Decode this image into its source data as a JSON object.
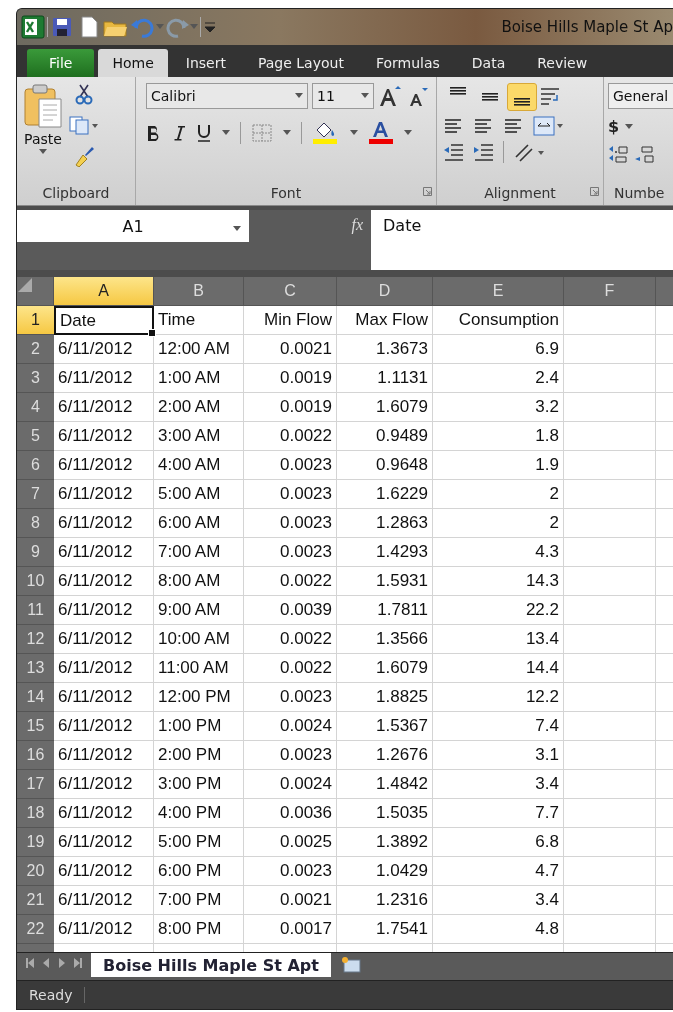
{
  "window": {
    "title": "Boise Hills Maple St Ap"
  },
  "tabs": [
    {
      "label": "File",
      "kind": "file",
      "selected": false
    },
    {
      "label": "Home",
      "kind": "tab",
      "selected": true
    },
    {
      "label": "Insert",
      "kind": "tab",
      "selected": false
    },
    {
      "label": "Page Layout",
      "kind": "tab",
      "selected": false
    },
    {
      "label": "Formulas",
      "kind": "tab",
      "selected": false
    },
    {
      "label": "Data",
      "kind": "tab",
      "selected": false
    },
    {
      "label": "Review",
      "kind": "tab",
      "selected": false
    }
  ],
  "ribbon": {
    "clipboard": {
      "label": "Clipboard",
      "paste": "Paste"
    },
    "font": {
      "label": "Font",
      "font_name": "Calibri",
      "font_size": "11"
    },
    "alignment": {
      "label": "Alignment",
      "vertical_align": [
        {
          "kind": "top",
          "selected": false
        },
        {
          "kind": "middle",
          "selected": false
        },
        {
          "kind": "bottom",
          "selected": true
        }
      ]
    },
    "number": {
      "label": "Numbe",
      "format": "General",
      "currency": "$"
    }
  },
  "formula_bar": {
    "name_box": "A1",
    "function_label": "fx",
    "content": "Date"
  },
  "columns": [
    {
      "label": "A",
      "selected": true
    },
    {
      "label": "B",
      "selected": false
    },
    {
      "label": "C",
      "selected": false
    },
    {
      "label": "D",
      "selected": false
    },
    {
      "label": "E",
      "selected": false
    },
    {
      "label": "F",
      "selected": false
    }
  ],
  "rows": [
    {
      "header": "1",
      "selected": true,
      "cells": [
        "Date",
        "Time",
        "Min Flow",
        "Max Flow",
        "Consumption"
      ]
    },
    {
      "header": "2",
      "selected": false,
      "cells": [
        "6/11/2012",
        "12:00 AM",
        "0.0021",
        "1.3673",
        "6.9"
      ]
    },
    {
      "header": "3",
      "selected": false,
      "cells": [
        "6/11/2012",
        "1:00 AM",
        "0.0019",
        "1.1131",
        "2.4"
      ]
    },
    {
      "header": "4",
      "selected": false,
      "cells": [
        "6/11/2012",
        "2:00 AM",
        "0.0019",
        "1.6079",
        "3.2"
      ]
    },
    {
      "header": "5",
      "selected": false,
      "cells": [
        "6/11/2012",
        "3:00 AM",
        "0.0022",
        "0.9489",
        "1.8"
      ]
    },
    {
      "header": "6",
      "selected": false,
      "cells": [
        "6/11/2012",
        "4:00 AM",
        "0.0023",
        "0.9648",
        "1.9"
      ]
    },
    {
      "header": "7",
      "selected": false,
      "cells": [
        "6/11/2012",
        "5:00 AM",
        "0.0023",
        "1.6229",
        "2"
      ]
    },
    {
      "header": "8",
      "selected": false,
      "cells": [
        "6/11/2012",
        "6:00 AM",
        "0.0023",
        "1.2863",
        "2"
      ]
    },
    {
      "header": "9",
      "selected": false,
      "cells": [
        "6/11/2012",
        "7:00 AM",
        "0.0023",
        "1.4293",
        "4.3"
      ]
    },
    {
      "header": "10",
      "selected": false,
      "cells": [
        "6/11/2012",
        "8:00 AM",
        "0.0022",
        "1.5931",
        "14.3"
      ]
    },
    {
      "header": "11",
      "selected": false,
      "cells": [
        "6/11/2012",
        "9:00 AM",
        "0.0039",
        "1.7811",
        "22.2"
      ]
    },
    {
      "header": "12",
      "selected": false,
      "cells": [
        "6/11/2012",
        "10:00 AM",
        "0.0022",
        "1.3566",
        "13.4"
      ]
    },
    {
      "header": "13",
      "selected": false,
      "cells": [
        "6/11/2012",
        "11:00 AM",
        "0.0022",
        "1.6079",
        "14.4"
      ]
    },
    {
      "header": "14",
      "selected": false,
      "cells": [
        "6/11/2012",
        "12:00 PM",
        "0.0023",
        "1.8825",
        "12.2"
      ]
    },
    {
      "header": "15",
      "selected": false,
      "cells": [
        "6/11/2012",
        "1:00 PM",
        "0.0024",
        "1.5367",
        "7.4"
      ]
    },
    {
      "header": "16",
      "selected": false,
      "cells": [
        "6/11/2012",
        "2:00 PM",
        "0.0023",
        "1.2676",
        "3.1"
      ]
    },
    {
      "header": "17",
      "selected": false,
      "cells": [
        "6/11/2012",
        "3:00 PM",
        "0.0024",
        "1.4842",
        "3.4"
      ]
    },
    {
      "header": "18",
      "selected": false,
      "cells": [
        "6/11/2012",
        "4:00 PM",
        "0.0036",
        "1.5035",
        "7.7"
      ]
    },
    {
      "header": "19",
      "selected": false,
      "cells": [
        "6/11/2012",
        "5:00 PM",
        "0.0025",
        "1.3892",
        "6.8"
      ]
    },
    {
      "header": "20",
      "selected": false,
      "cells": [
        "6/11/2012",
        "6:00 PM",
        "0.0023",
        "1.0429",
        "4.7"
      ]
    },
    {
      "header": "21",
      "selected": false,
      "cells": [
        "6/11/2012",
        "7:00 PM",
        "0.0021",
        "1.2316",
        "3.4"
      ]
    },
    {
      "header": "22",
      "selected": false,
      "cells": [
        "6/11/2012",
        "8:00 PM",
        "0.0017",
        "1.7541",
        "4.8"
      ]
    }
  ],
  "sheet_tabs": [
    {
      "label": "Boise Hills Maple St Apt",
      "selected": true
    }
  ],
  "status_bar": {
    "text": "Ready"
  }
}
